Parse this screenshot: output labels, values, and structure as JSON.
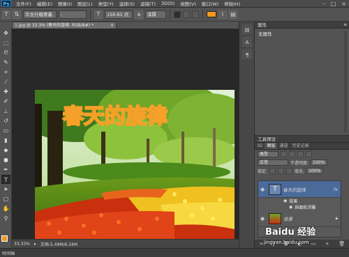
{
  "menubar": {
    "logo": "Ps",
    "items": [
      "文件(F)",
      "编辑(E)",
      "图像(I)",
      "图层(L)",
      "类型(Y)",
      "选择(S)",
      "滤镜(T)",
      "3D(D)",
      "视图(V)",
      "窗口(W)",
      "帮助(H)"
    ],
    "controls": [
      "–",
      "□",
      "×"
    ]
  },
  "options": {
    "font_family": "华文行楷青墨",
    "font_style": "-",
    "font_size": "150.61 点",
    "antialias": "浑厚",
    "text_color": "#f39a1e"
  },
  "document": {
    "tab_label": "1.jpg @ 33.3% (春天的旋律, RGB/8#) *",
    "tab_close": "×",
    "art_text": "春天的旋律"
  },
  "status": {
    "zoom": "33.33%",
    "doc_info": "文档:5.49M/6.24M"
  },
  "bottom_bar": {
    "label": "时间轴"
  },
  "properties": {
    "title": "属性",
    "body": "无属性"
  },
  "layers": {
    "tabs": [
      "3D",
      "图层",
      "通道",
      "历史记录"
    ],
    "panel_title": "工具预设",
    "filter_kind": "类型",
    "blend_mode": "正常",
    "opacity_label": "不透明度:",
    "opacity": "100%",
    "lock_label": "锁定:",
    "fill_label": "填充:",
    "fill": "100%",
    "items": [
      {
        "name": "春天的旋律",
        "type_badge": "T",
        "fx": "fx"
      },
      {
        "name": "背景"
      }
    ],
    "effects_label": "效果",
    "effect_item": "斜面和浮雕"
  },
  "watermark": {
    "text": "Baidu 经验",
    "url": "jingyan.baidu.com"
  }
}
